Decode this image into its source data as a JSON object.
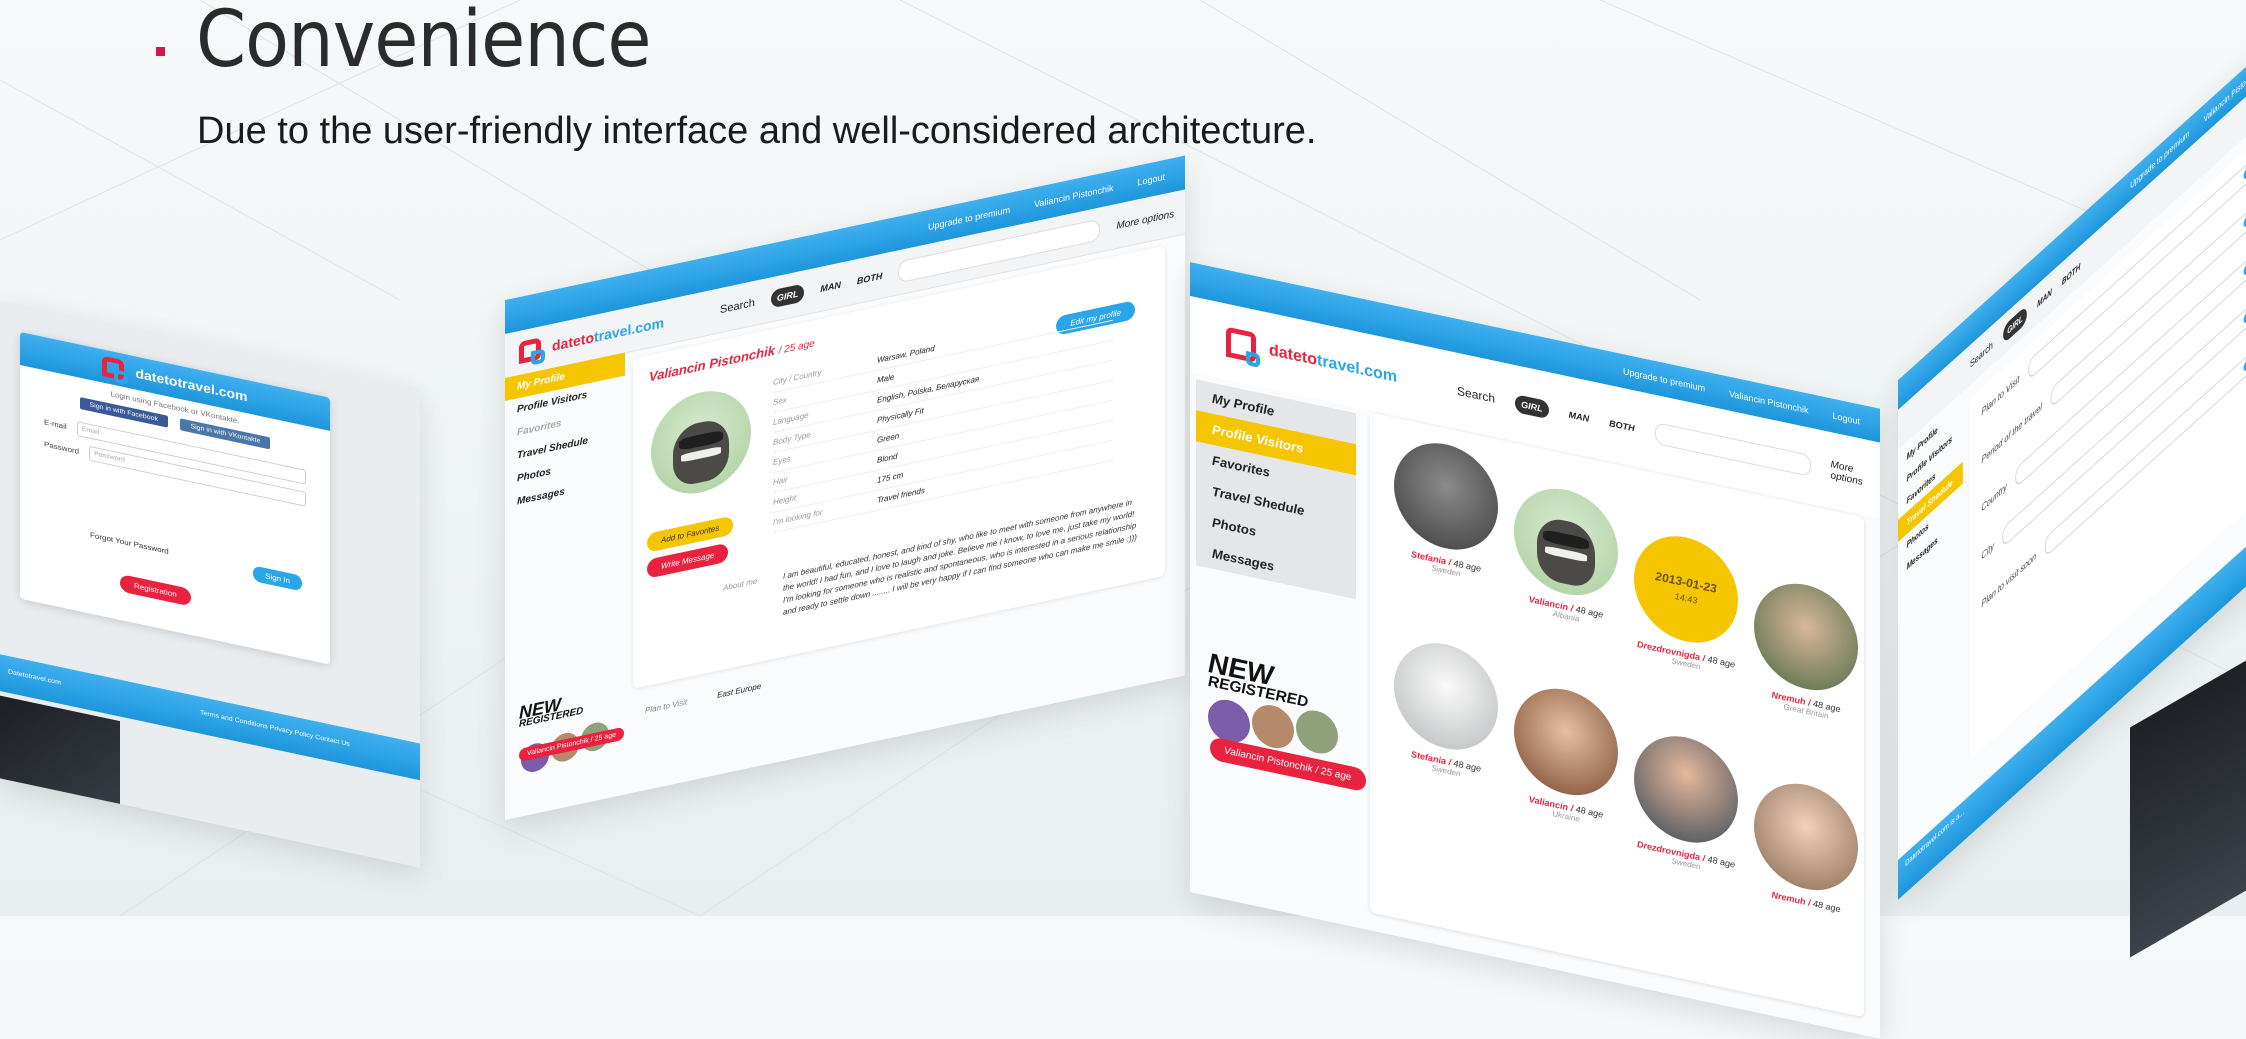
{
  "heading": "Convenience",
  "subtitle": "Due to the user-friendly interface and well-considered architecture.",
  "brand": {
    "part1": "dateto",
    "part2": "travel",
    "part3": ".com"
  },
  "colors": {
    "accent_red": "#e9223f",
    "accent_blue": "#2aa6e8",
    "accent_yellow": "#f5c500",
    "bullet": "#d2184f"
  },
  "login": {
    "intro": "Login using Facebook or VKontakte.",
    "facebook": "Sign in with Facebook",
    "vk": "Sign in with VKontakte",
    "email_label": "E-mail",
    "email_placeholder": "Email",
    "password_label": "Password",
    "password_placeholder": "Password",
    "forgot": "Forgot Your Password",
    "sign_in": "Sign In",
    "registration": "Registration",
    "footer_links": "Terms and Conditions   Privacy Policy   Contact Us",
    "copyright": "Datetotravel.com"
  },
  "topbar": {
    "upgrade": "Upgrade to premium",
    "user": "Valiancin Pistonchik",
    "logout": "Logout"
  },
  "search": {
    "label": "Search",
    "girl": "GIRL",
    "man": "MAN",
    "both": "BOTH",
    "more": "More options"
  },
  "sidebar": [
    {
      "label": "My Profile",
      "icon": "person-icon"
    },
    {
      "label": "Profile Visitors",
      "icon": "people-icon"
    },
    {
      "label": "Favorites",
      "icon": "heart-icon"
    },
    {
      "label": "Travel Shedule",
      "icon": "suitcase-icon"
    },
    {
      "label": "Photos",
      "icon": "camera-icon"
    },
    {
      "label": "Messages",
      "icon": "chat-icon"
    }
  ],
  "profile": {
    "name": "Valiancin Pistonchik",
    "age": "/ 25 age",
    "edit": "Edit my profile",
    "fields": [
      {
        "k": "City / Country",
        "v": "Warsaw, Poland"
      },
      {
        "k": "Sex",
        "v": "Male"
      },
      {
        "k": "Language",
        "v": "English, Polska, Беларуская"
      },
      {
        "k": "Body Type",
        "v": "Physically Fit"
      },
      {
        "k": "Eyes",
        "v": "Green"
      },
      {
        "k": "Hair",
        "v": "Blond"
      },
      {
        "k": "Height",
        "v": "175 cm"
      },
      {
        "k": "I'm looking for",
        "v": "Travel friends"
      }
    ],
    "about_label": "About me",
    "about": "I am beautiful, educated, honest, and kind of shy, who like to meet with someone from anywhere in the world! I had fun, and I love to laugh and joke. Believe me I know, to love me, just take my world! I'm looking for someone who is realistic and spontaneous, who is interested in a serious relationship and ready to settle down ........ I will be very happy if I can find someone who can make me smile :)))",
    "add_fav": "Add to Favorites",
    "write_msg": "Write Message",
    "plan_label": "Plan to Visit",
    "plan_value": "East Europe"
  },
  "new_registered": {
    "line1": "NEW",
    "line2": "REGISTERED",
    "banner": "Valiancin Pistonchik / 25 age"
  },
  "visitors": [
    {
      "name": "Stefania",
      "age": "48 age",
      "country": "Sweden"
    },
    {
      "name": "Valiancin",
      "age": "48 age",
      "country": "Albania"
    },
    {
      "name": "Drezdrovnigda",
      "age": "48 age",
      "country": "Sweden",
      "date": "2013-01-23",
      "time": "14:43"
    },
    {
      "name": "Nremuh",
      "age": "48 age",
      "country": "Great Britain"
    },
    {
      "name": "Stefania",
      "age": "48 age",
      "country": "Sweden"
    },
    {
      "name": "Valiancin",
      "age": "48 age",
      "country": "Ukraine"
    },
    {
      "name": "Drezdrovnigda",
      "age": "48 age",
      "country": "Sweden"
    },
    {
      "name": "Nremuh",
      "age": "48 age",
      "country": ""
    }
  ],
  "search_form": {
    "plan": "Plan to Visit",
    "period": "Period of the travel",
    "country": "Country",
    "city": "City",
    "plan_soon": "Plan to visit soon",
    "footer": "Datetotravel.com is a..."
  }
}
